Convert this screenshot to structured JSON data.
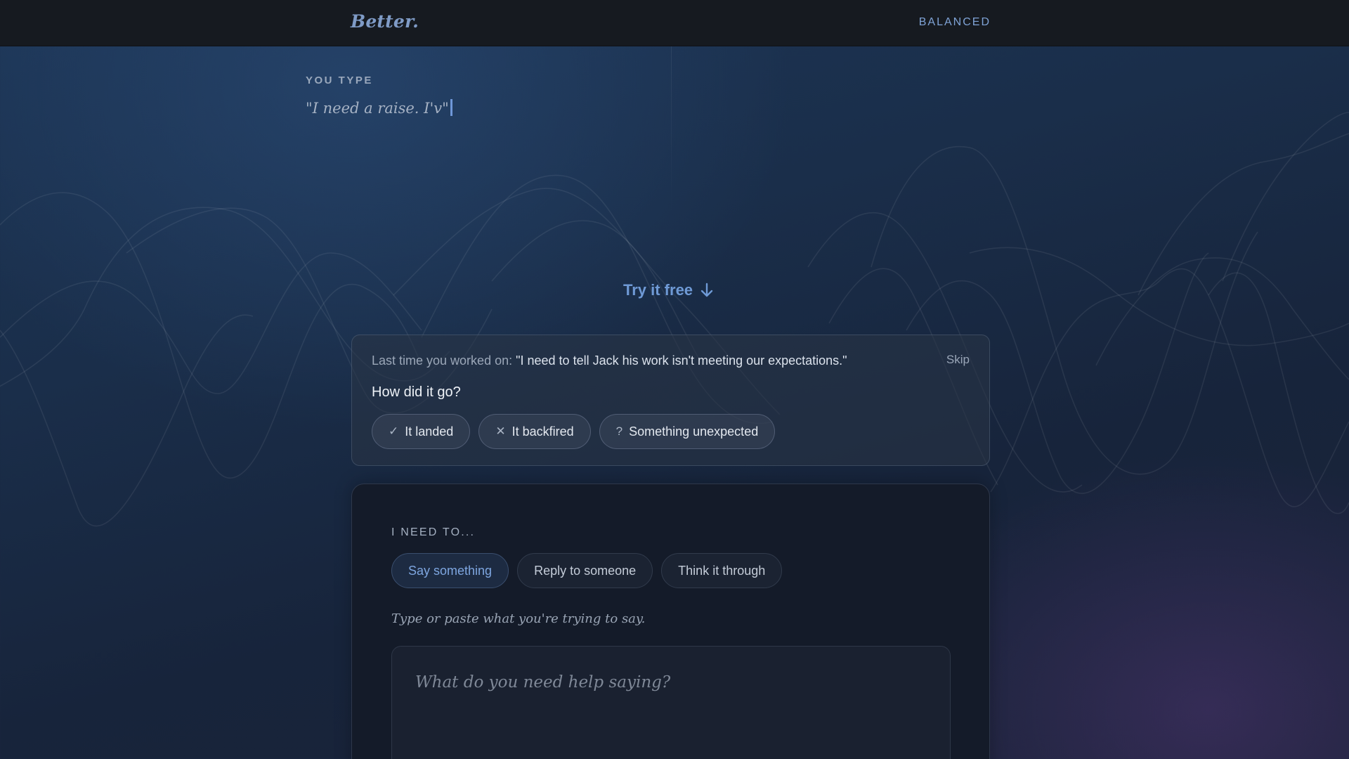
{
  "header": {
    "logo": "Better.",
    "mode": "BALANCED"
  },
  "hero": {
    "you_type_label": "YOU TYPE",
    "typed_text": "\"I need a raise. I'v\"",
    "cta": "Try it free"
  },
  "feedback": {
    "last_time_prefix": "Last time you worked on:",
    "last_time_quote": "\"I need to tell Jack his work isn't meeting our expectations.\"",
    "skip": "Skip",
    "question": "How did it go?",
    "options": [
      {
        "icon": "check-icon",
        "glyph": "✓",
        "label": "It landed"
      },
      {
        "icon": "x-icon",
        "glyph": "✕",
        "label": "It backfired"
      },
      {
        "icon": "question-icon",
        "glyph": "?",
        "label": "Something unexpected"
      }
    ]
  },
  "composer": {
    "need_label": "I NEED TO...",
    "modes": [
      {
        "label": "Say something",
        "active": true
      },
      {
        "label": "Reply to someone",
        "active": false
      },
      {
        "label": "Think it through",
        "active": false
      }
    ],
    "hint": "Type or paste what you're trying to say.",
    "input_value": "",
    "input_placeholder": "What do you need help saying?"
  },
  "colors": {
    "accent": "#7fa3d6",
    "panel": "#141b29",
    "background": "#1a2e4a"
  }
}
